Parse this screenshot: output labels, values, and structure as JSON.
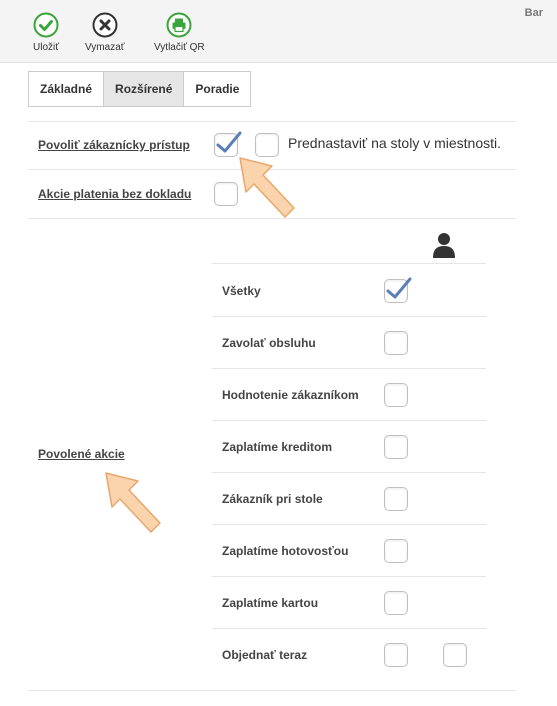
{
  "toolbar": {
    "buttons": [
      {
        "label": "Uložiť",
        "icon": "check-circle-icon",
        "color": "#3aa53a"
      },
      {
        "label": "Vymazať",
        "icon": "x-circle-icon",
        "color": "#333333"
      },
      {
        "label": "Vytlačiť QR",
        "icon": "printer-icon",
        "color": "#3aa53a"
      }
    ],
    "right_label": "Bar"
  },
  "tabs": [
    {
      "label": "Základné",
      "active": false
    },
    {
      "label": "Rozšírené",
      "active": true
    },
    {
      "label": "Poradie",
      "active": false
    }
  ],
  "settings": {
    "customer_access": {
      "label": "Povoliť zákaznícky prístup",
      "checked": true,
      "preset_label": "Prednastaviť na stoly v miestnosti.",
      "preset_checked": false
    },
    "payment_no_receipt": {
      "label": "Akcie platenia bez dokladu",
      "checked": false
    },
    "allowed_actions": {
      "label": "Povolené akcie",
      "header_icon": "person-icon",
      "items": [
        {
          "label": "Všetky",
          "checked": true
        },
        {
          "label": "Zavolať obsluhu",
          "checked": false
        },
        {
          "label": "Hodnotenie zákazníkom",
          "checked": false
        },
        {
          "label": "Zaplatíme kreditom",
          "checked": false
        },
        {
          "label": "Zákazník pri stole",
          "checked": false
        },
        {
          "label": "Zaplatíme hotovosťou",
          "checked": false
        },
        {
          "label": "Zaplatíme kartou",
          "checked": false
        },
        {
          "label": "Objednať teraz",
          "checked": false,
          "second_checked": false
        }
      ]
    }
  },
  "colors": {
    "accent_check": "#5b7fb5",
    "arrow": "#f7c9a0"
  }
}
